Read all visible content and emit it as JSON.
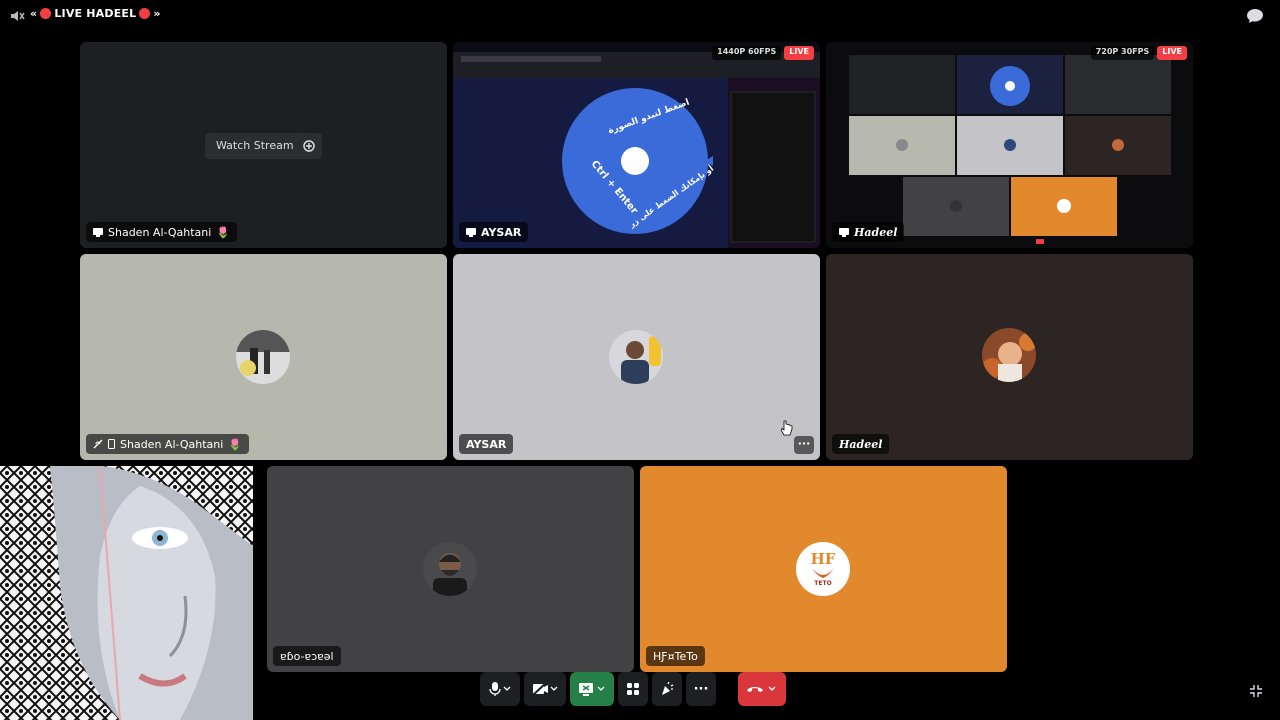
{
  "header": {
    "prefix": "«",
    "title": "LIVE HADEEL",
    "suffix": "»"
  },
  "tiles": {
    "t1": {
      "name": "Shaden Al-Qahtani",
      "emoji": "🌷",
      "watch_label": "Watch Stream"
    },
    "t2": {
      "name": "AYSAR",
      "quality": "1440P 60FPS",
      "live": "LIVE"
    },
    "t3": {
      "name": "Hadeel",
      "quality": "720P 30FPS",
      "live": "LIVE"
    },
    "t4": {
      "name": "Shaden Al-Qahtani",
      "emoji": "🌷"
    },
    "t5": {
      "name": "AYSAR",
      "more": "···"
    },
    "t6": {
      "name": "Hadeel"
    },
    "t7": {
      "name": "ɐɓo-ɐɔɐǝl"
    },
    "t8": {
      "name": "HƑ¤TeTo",
      "logo_text": "HF",
      "logo_sub": "TETO"
    }
  },
  "stream_content": {
    "disc_text_1": "اضغط لتبدو الصورة",
    "disc_text_2": "Ctrl + Enter",
    "disc_text_3": "أو بإمكانك الضغط على زر"
  },
  "controls": {
    "more_label": "···"
  },
  "colors": {
    "background": "#000000",
    "live_red": "#f23f43",
    "orange_tile": "#e2892e",
    "end_call": "#da373c",
    "screen_share_green": "#248046"
  }
}
